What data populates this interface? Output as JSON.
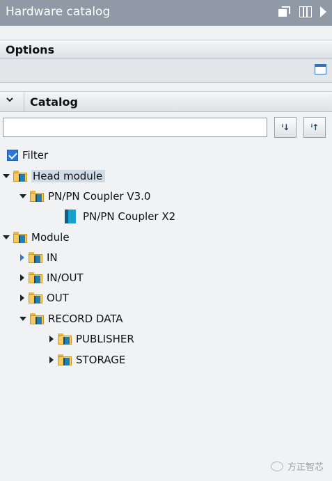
{
  "window": {
    "title": "Hardware catalog"
  },
  "options": {
    "label": "Options"
  },
  "catalog": {
    "label": "Catalog",
    "search": {
      "value": "",
      "placeholder": ""
    },
    "sort_down_label": "ⁱ↓",
    "sort_up_label": "ⁱ↑"
  },
  "filter": {
    "label": "Filter",
    "checked": true
  },
  "tree": [
    {
      "label": "Head module",
      "level": 0,
      "expander": "down",
      "icon": "folder-module-icon",
      "selected": true
    },
    {
      "label": "PN/PN Coupler V3.0",
      "level": 1,
      "expander": "down",
      "icon": "folder-module-icon"
    },
    {
      "label": "PN/PN Coupler X2",
      "level": 2,
      "expander": "none",
      "icon": "device-module-icon"
    },
    {
      "label": "Module",
      "level": 0,
      "expander": "down",
      "icon": "folder-module-icon"
    },
    {
      "label": "IN",
      "level": 1,
      "expander": "right-blue",
      "icon": "folder-module-icon"
    },
    {
      "label": "IN/OUT",
      "level": 1,
      "expander": "right",
      "icon": "folder-module-icon"
    },
    {
      "label": "OUT",
      "level": 1,
      "expander": "right",
      "icon": "folder-module-icon"
    },
    {
      "label": "RECORD DATA",
      "level": 1,
      "expander": "down",
      "icon": "folder-module-icon"
    },
    {
      "label": "PUBLISHER",
      "level": 2,
      "expander": "right",
      "icon": "folder-module-icon"
    },
    {
      "label": "STORAGE",
      "level": 2,
      "expander": "right",
      "icon": "folder-module-icon"
    }
  ],
  "watermark": {
    "text": "方正智芯"
  },
  "colors": {
    "titlebar": "#8f9aa6",
    "accent": "#2b78d7",
    "selection": "#cfdbe6"
  }
}
